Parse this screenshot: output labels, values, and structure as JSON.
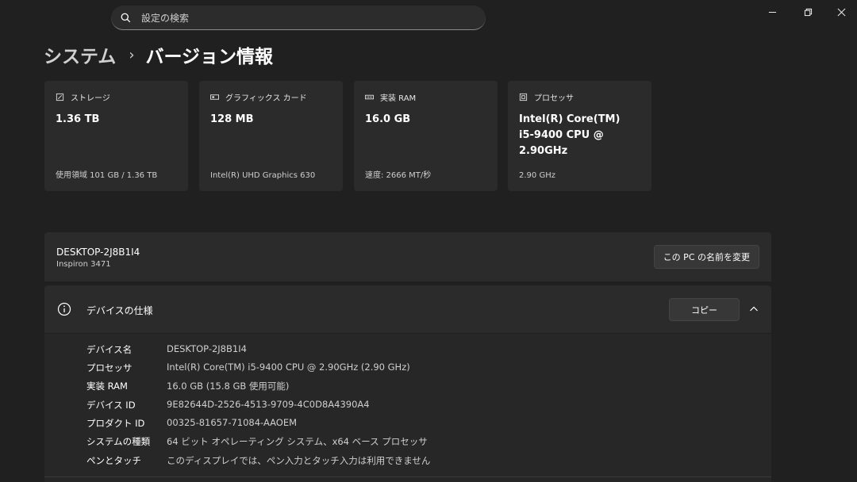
{
  "search": {
    "placeholder": "設定の検索"
  },
  "breadcrumb": {
    "parent": "システム",
    "separator": "›",
    "current": "バージョン情報"
  },
  "cards": [
    {
      "icon": "storage-icon",
      "title": "ストレージ",
      "value": "1.36 TB",
      "sub": "使用領域 101 GB / 1.36 TB"
    },
    {
      "icon": "graphics-card-icon",
      "title": "グラフィックス カード",
      "value": "128 MB",
      "sub": "Intel(R) UHD Graphics 630"
    },
    {
      "icon": "ram-icon",
      "title": "実装 RAM",
      "value": "16.0 GB",
      "sub": "速度: 2666 MT/秒"
    },
    {
      "icon": "processor-icon",
      "title": "プロセッサ",
      "value_lines": [
        "Intel(R) Core(TM)",
        "i5-9400 CPU @",
        "2.90GHz"
      ],
      "sub": "2.90 GHz"
    }
  ],
  "pc": {
    "name": "DESKTOP-2J8B1I4",
    "model": "Inspiron 3471",
    "rename_label": "この PC の名前を変更"
  },
  "device_spec": {
    "title": "デバイスの仕様",
    "copy_label": "コピー",
    "rows": [
      {
        "label": "デバイス名",
        "value": "DESKTOP-2J8B1I4"
      },
      {
        "label": "プロセッサ",
        "value": "Intel(R) Core(TM) i5-9400 CPU @ 2.90GHz (2.90 GHz)"
      },
      {
        "label": "実装 RAM",
        "value": "16.0 GB (15.8 GB 使用可能)"
      },
      {
        "label": "デバイス ID",
        "value": "9E82644D-2526-4513-9709-4C0D8A4390A4"
      },
      {
        "label": "プロダクト ID",
        "value": "00325-81657-71084-AAOEM"
      },
      {
        "label": "システムの種類",
        "value": "64 ビット オペレーティング システム、x64 ベース プロセッサ"
      },
      {
        "label": "ペンとタッチ",
        "value": "このディスプレイでは、ペン入力とタッチ入力は利用できません"
      }
    ]
  }
}
